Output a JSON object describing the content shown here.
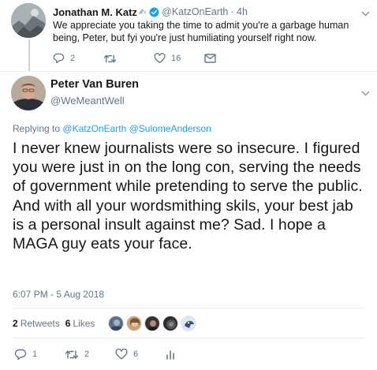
{
  "parent_tweet": {
    "author_name": "Jonathan M. Katz",
    "author_handle": "@KatzOnEarth",
    "time": "· 4h",
    "text": "We appreciate you taking the time to admit you're a garbage human being, Peter, but fyi you're just humiliating yourself right now.",
    "reply_count": "2",
    "retweet_count": "",
    "like_count": "16"
  },
  "main_tweet": {
    "author_name": "Peter Van Buren",
    "author_handle": "@WeMeantWell",
    "replying_prefix": "Replying to",
    "replying_to": [
      "@KatzOnEarth",
      "@SulomeAnderson"
    ],
    "text": "I never knew journalists were so insecure. I figured you were just in on the long con, serving the needs of government while pretending to serve the public. And with all your wordsmithing skils, your best jab is a personal insult against me? Sad. I hope a MAGA guy eats your face.",
    "timestamp": "6:07 PM - 5 Aug 2018",
    "retweets_count": "2",
    "retweets_label": "Retweets",
    "likes_count": "6",
    "likes_label": "Likes",
    "reply_count": "1",
    "retweet_count": "2",
    "like_count": "6"
  },
  "colors": {
    "link": "#1da1f2",
    "muted": "#657786",
    "text": "#14171a",
    "divider": "#e6ecf0"
  }
}
